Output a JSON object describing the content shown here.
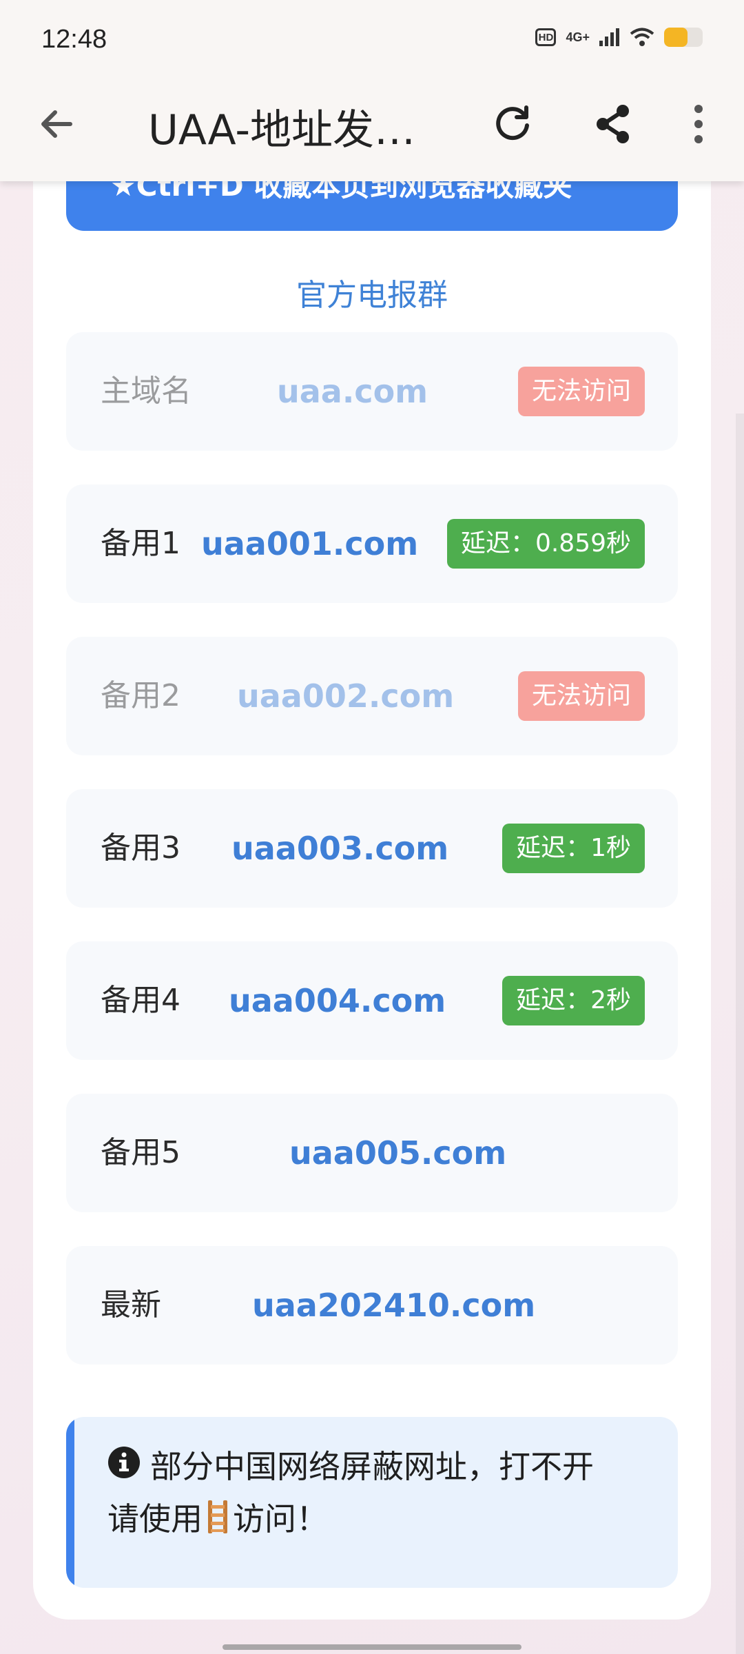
{
  "status_bar": {
    "time": "12:48",
    "hd_label": "HD",
    "network_label": "4G+",
    "battery_level": 0.6
  },
  "app_bar": {
    "title": "UAA-地址发…",
    "icons": [
      "back-arrow-icon",
      "refresh-icon",
      "share-icon",
      "more-vert-icon"
    ]
  },
  "banner": {
    "label": "★Ctrl+D 收藏本页到浏览器收藏夹",
    "color": "#3f82ec"
  },
  "telegram_link": "官方电报群",
  "domains": [
    {
      "label": "主域名",
      "domain": "uaa.com",
      "badge": "无法访问",
      "status": "error"
    },
    {
      "label": "备用1",
      "domain": "uaa001.com",
      "badge": "延迟：0.859秒",
      "status": "ok"
    },
    {
      "label": "备用2",
      "domain": "uaa002.com",
      "badge": "无法访问",
      "status": "error"
    },
    {
      "label": "备用3",
      "domain": "uaa003.com",
      "badge": "延迟：1秒",
      "status": "ok"
    },
    {
      "label": "备用4",
      "domain": "uaa004.com",
      "badge": "延迟：2秒",
      "status": "ok"
    },
    {
      "label": "备用5",
      "domain": "uaa005.com",
      "badge": "",
      "status": "none"
    },
    {
      "label": "最新",
      "domain": "uaa202410.com",
      "badge": "",
      "status": "none"
    }
  ],
  "notice": {
    "line1": "部分中国网络屏蔽网址，打不开",
    "line2_before": "请使用",
    "line2_after": "访问！",
    "icons": [
      "info-icon",
      "ladder-icon"
    ]
  },
  "colors": {
    "accent": "#3f82ec",
    "link": "#3f7fd6",
    "error_badge": "#f7a29c",
    "ok_badge": "#4eae4e"
  }
}
